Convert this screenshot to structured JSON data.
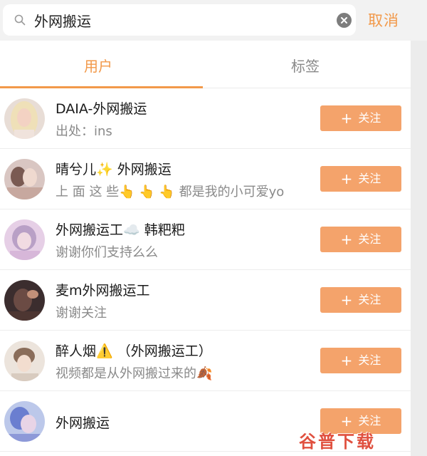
{
  "search": {
    "query": "外网搬运",
    "cancel_label": "取消"
  },
  "tabs": [
    {
      "label": "用户",
      "active": true
    },
    {
      "label": "标签",
      "active": false
    }
  ],
  "users": [
    {
      "name": "DAIA-外网搬运",
      "desc": "出处：ins",
      "follow_label": "关注"
    },
    {
      "name": "晴兮儿✨ 外网搬运",
      "desc": "上 面 这 些👆 👆 👆 都是我的小可爱yo",
      "follow_label": "关注"
    },
    {
      "name": "外网搬运工☁️ 韩粑粑",
      "desc": "谢谢你们支持么么",
      "follow_label": "关注"
    },
    {
      "name": "麦m外网搬运工",
      "desc": "谢谢关注",
      "follow_label": "关注"
    },
    {
      "name": "醉人烟⚠️ （外网搬运工）",
      "desc": "视频都是从外网搬过来的🍂",
      "follow_label": "关注"
    },
    {
      "name": "外网搬运",
      "desc": "",
      "follow_label": "关注"
    }
  ],
  "watermark": "谷普下载",
  "colors": {
    "accent": "#f2994a",
    "follow_button": "#f4a36b",
    "watermark": "#e0503f"
  }
}
